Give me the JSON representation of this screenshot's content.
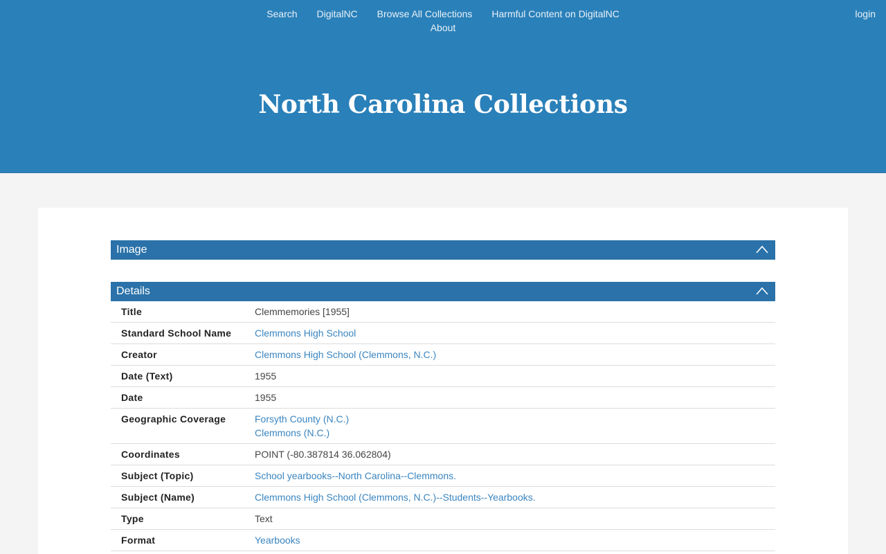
{
  "nav": {
    "items": [
      "Search",
      "DigitalNC",
      "Browse All Collections",
      "Harmful Content on DigitalNC",
      "About"
    ],
    "login": "login"
  },
  "site_title": "North Carolina Collections",
  "panels": {
    "image_label": "Image",
    "details_label": "Details"
  },
  "details": [
    {
      "label": "Title",
      "values": [
        "Clemmemories [1955]"
      ],
      "link": false
    },
    {
      "label": "Standard School Name",
      "values": [
        "Clemmons High School"
      ],
      "link": true
    },
    {
      "label": "Creator",
      "values": [
        "Clemmons High School (Clemmons, N.C.)"
      ],
      "link": true
    },
    {
      "label": "Date (Text)",
      "values": [
        "1955"
      ],
      "link": false
    },
    {
      "label": "Date",
      "values": [
        "1955"
      ],
      "link": false
    },
    {
      "label": "Geographic Coverage",
      "values": [
        "Forsyth County (N.C.)",
        "Clemmons (N.C.)"
      ],
      "link": true
    },
    {
      "label": "Coordinates",
      "values": [
        "POINT (-80.387814 36.062804)"
      ],
      "link": false
    },
    {
      "label": "Subject (Topic)",
      "values": [
        "School yearbooks--North Carolina--Clemmons."
      ],
      "link": true
    },
    {
      "label": "Subject (Name)",
      "values": [
        "Clemmons High School (Clemmons, N.C.)--Students--Yearbooks."
      ],
      "link": true
    },
    {
      "label": "Type",
      "values": [
        "Text"
      ],
      "link": false
    },
    {
      "label": "Format",
      "values": [
        "Yearbooks"
      ],
      "link": true
    }
  ],
  "colors": {
    "header_bg": "#2a80b9",
    "panel_head_bg": "#2a72a9",
    "link": "#3a85c0",
    "page_bg": "#f4f4f4"
  },
  "icons": {
    "panel_toggle": "chevron-up-icon"
  }
}
